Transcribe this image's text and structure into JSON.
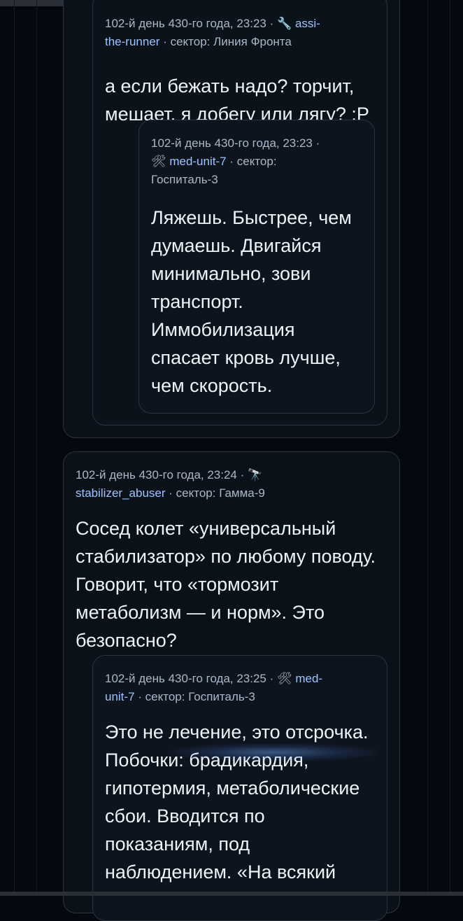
{
  "posts": [
    {
      "timestamp": "102-й день 430-го года, 23:23",
      "icon": "🔧",
      "author": "assi-the-runner",
      "author_line1": "assi-",
      "author_line2": "the-runner",
      "sector": "сектор: Линия Фронта",
      "text_lines": [
        "а если бежать надо? торчит,",
        "мешает. я добегу или лягу? :P"
      ]
    },
    {
      "timestamp": "102-й день 430-го года, 23:23 ·",
      "icon": "🛠",
      "author": "med-unit-7",
      "sector": "сектор:",
      "sector_line2": "Госпиталь-3",
      "text_lines": [
        "Ляжешь. Быстрее, чем",
        "думаешь. Двигайся",
        "минимально, зови",
        "транспорт.",
        "Иммобилизация",
        "спасает кровь лучше,",
        "чем скорость."
      ]
    },
    {
      "timestamp": "102-й день 430-го года, 23:24 ·",
      "icon": "🔭",
      "author": "stabilizer_abuser",
      "sector": "сектор: Гамма-9",
      "text_lines": [
        "Сосед колет «универсальный",
        "стабилизатор» по любому поводу.",
        "Говорит, что «тормозит",
        "метаболизм — и норм». Это",
        "безопасно?"
      ]
    },
    {
      "timestamp": "102-й день 430-го года, 23:25 ·",
      "icon": "🛠",
      "author_line1": "med-",
      "author_line2": "unit-7",
      "sector": "сектор: Госпиталь-3",
      "text_lines": [
        "Это не лечение, это отсрочка.",
        "Побочки: брадикардия,",
        "гипотермия, метаболические",
        "сбои. Вводится по",
        "показаниям, под",
        "наблюдением. «На всякий"
      ]
    }
  ],
  "separator": "·"
}
